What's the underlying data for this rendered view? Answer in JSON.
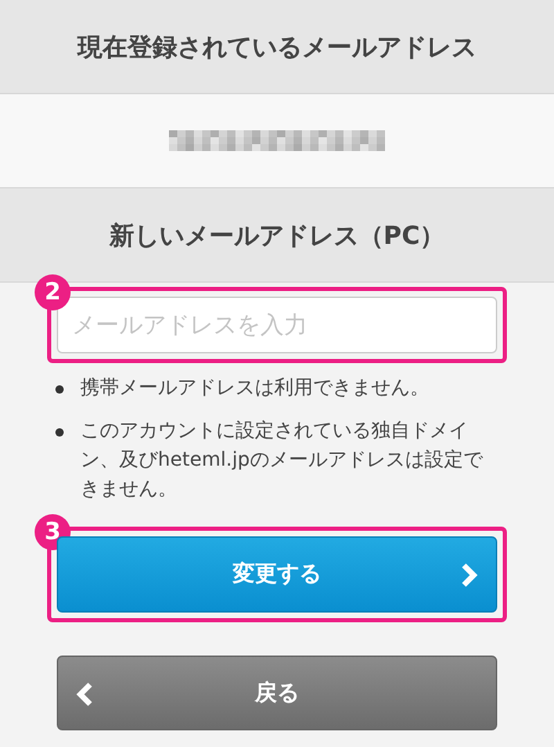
{
  "current_email": {
    "heading": "現在登録されているメールアドレス"
  },
  "new_email": {
    "heading": "新しいメールアドレス（PC）",
    "field": {
      "placeholder": "メールアドレスを入力",
      "callout": "2"
    }
  },
  "notes": [
    "携帯メールアドレスは利用できません。",
    "このアカウントに設定されている独自ドメイン、及びheteml.jpのメールアドレスは設定できません。"
  ],
  "submit": {
    "label": "変更する",
    "callout": "3"
  },
  "back": {
    "label": "戻る"
  }
}
